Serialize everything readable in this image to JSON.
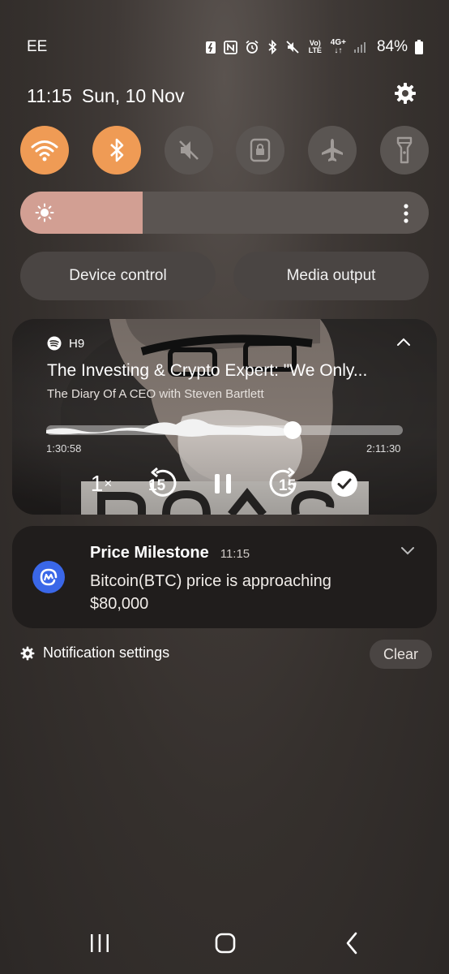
{
  "status_bar": {
    "carrier": "EE",
    "network_icon_label": "Vo) LTE",
    "network_type": "4G+",
    "battery": "84%"
  },
  "header": {
    "time": "11:15",
    "date": "Sun, 10 Nov"
  },
  "quick_settings": [
    {
      "name": "wifi",
      "on": true
    },
    {
      "name": "bluetooth",
      "on": true
    },
    {
      "name": "mute",
      "on": false
    },
    {
      "name": "rotation-lock",
      "on": false
    },
    {
      "name": "airplane-mode",
      "on": false
    },
    {
      "name": "flashlight",
      "on": false
    }
  ],
  "brightness": {
    "level": 0.3
  },
  "buttons": {
    "device_control": "Device control",
    "media_output": "Media output"
  },
  "media": {
    "source": "H9",
    "title": "The Investing & Crypto Expert: \"We Only...",
    "subtitle": "The Diary Of A CEO with Steven Bartlett",
    "elapsed": "1:30:58",
    "total": "2:11:30",
    "progress": 0.69,
    "speed": "1",
    "speed_suffix": "×",
    "rewind_label": "15",
    "forward_label": "15"
  },
  "notification": {
    "title": "Price Milestone",
    "time": "11:15",
    "body": "Bitcoin(BTC) price is approaching $80,000"
  },
  "footer": {
    "settings_label": "Notification settings",
    "clear_label": "Clear"
  },
  "colors": {
    "accent": "#ef9b55",
    "brightness_fill": "#d29f93",
    "notif_icon": "#3a67e8"
  }
}
